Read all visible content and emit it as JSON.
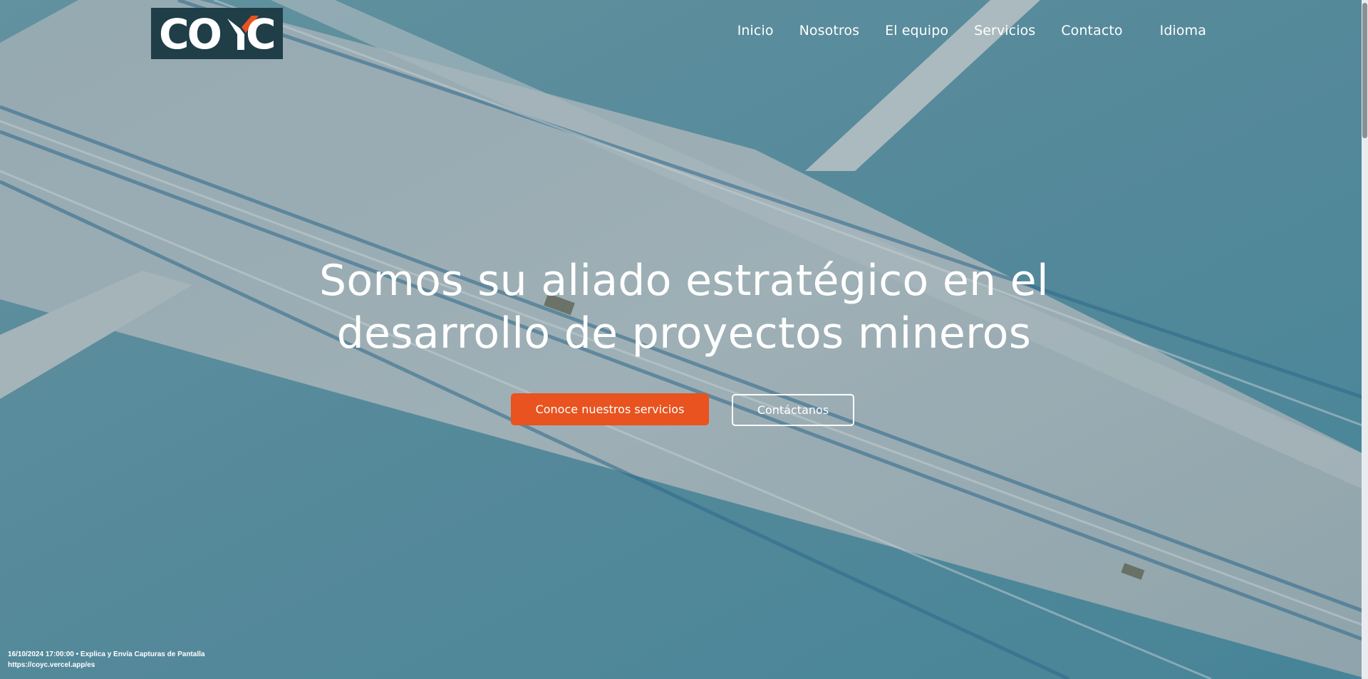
{
  "brand": {
    "logo_text": "COYC",
    "logo_bg": "#1f3e47",
    "logo_accent": "#e8531f"
  },
  "nav": {
    "items": [
      "Inicio",
      "Nosotros",
      "El equipo",
      "Servicios",
      "Contacto"
    ],
    "language_label": "Idioma"
  },
  "hero": {
    "title": "Somos su aliado estratégico en el desarrollo de proyectos mineros",
    "primary_cta": "Conoce nuestros servicios",
    "secondary_cta": "Contáctanos",
    "primary_color": "#e8531f"
  },
  "stamp": {
    "line1": "16/10/2024 17:00:00 • Explica y Envía Capturas de Pantalla",
    "line2": "https://coyc.vercel.app/es"
  }
}
